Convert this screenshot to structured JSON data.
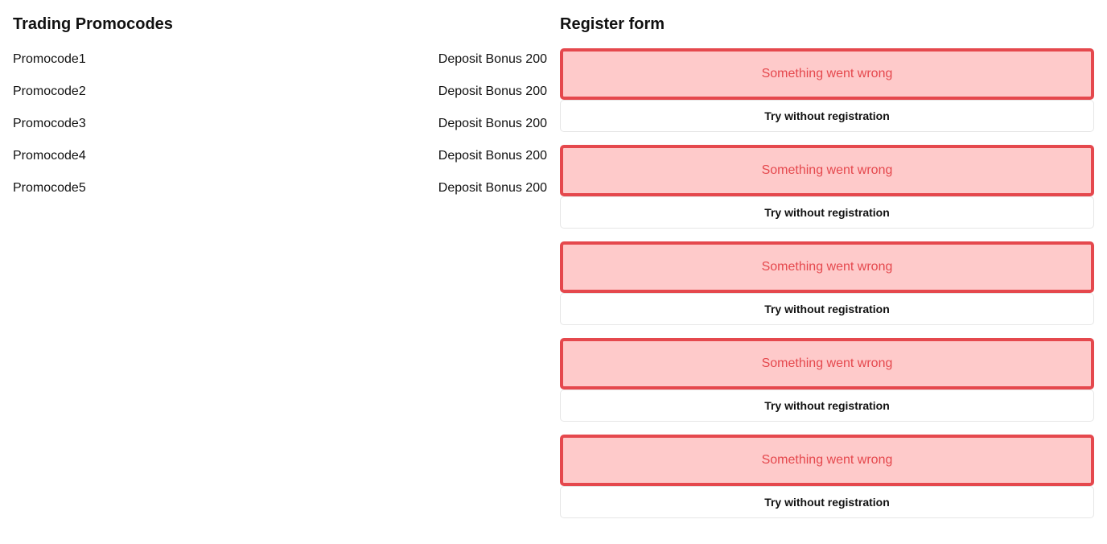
{
  "promocodes": {
    "title": "Trading Promocodes",
    "items": [
      {
        "code": "Promocode1",
        "bonus": "Deposit Bonus 200"
      },
      {
        "code": "Promocode2",
        "bonus": "Deposit Bonus 200"
      },
      {
        "code": "Promocode3",
        "bonus": "Deposit Bonus 200"
      },
      {
        "code": "Promocode4",
        "bonus": "Deposit Bonus 200"
      },
      {
        "code": "Promocode5",
        "bonus": "Deposit Bonus 200"
      }
    ]
  },
  "register": {
    "title": "Register form",
    "forms": [
      {
        "error": "Something went wrong",
        "button": "Try without registration"
      },
      {
        "error": "Something went wrong",
        "button": "Try without registration"
      },
      {
        "error": "Something went wrong",
        "button": "Try without registration"
      },
      {
        "error": "Something went wrong",
        "button": "Try without registration"
      },
      {
        "error": "Something went wrong",
        "button": "Try without registration"
      }
    ]
  },
  "colors": {
    "error_border": "#e5484d",
    "error_background": "#fecaca",
    "error_text": "#e5484d",
    "button_border": "#e6e6e6"
  }
}
